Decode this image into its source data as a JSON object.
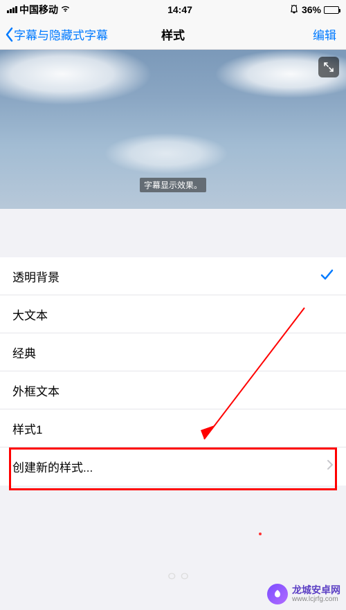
{
  "status": {
    "carrier": "中国移动",
    "time": "14:47",
    "battery_pct": "36%"
  },
  "nav": {
    "back_label": "字幕与隐藏式字幕",
    "title": "样式",
    "edit": "编辑"
  },
  "preview": {
    "caption": "字幕显示效果。"
  },
  "styles": [
    {
      "label": "透明背景",
      "selected": true
    },
    {
      "label": "大文本",
      "selected": false
    },
    {
      "label": "经典",
      "selected": false
    },
    {
      "label": "外框文本",
      "selected": false
    },
    {
      "label": "样式1",
      "selected": false
    }
  ],
  "create_new": {
    "label": "创建新的样式..."
  },
  "watermark": {
    "name": "龙城安卓网",
    "url": "www.lcjrfg.com"
  }
}
